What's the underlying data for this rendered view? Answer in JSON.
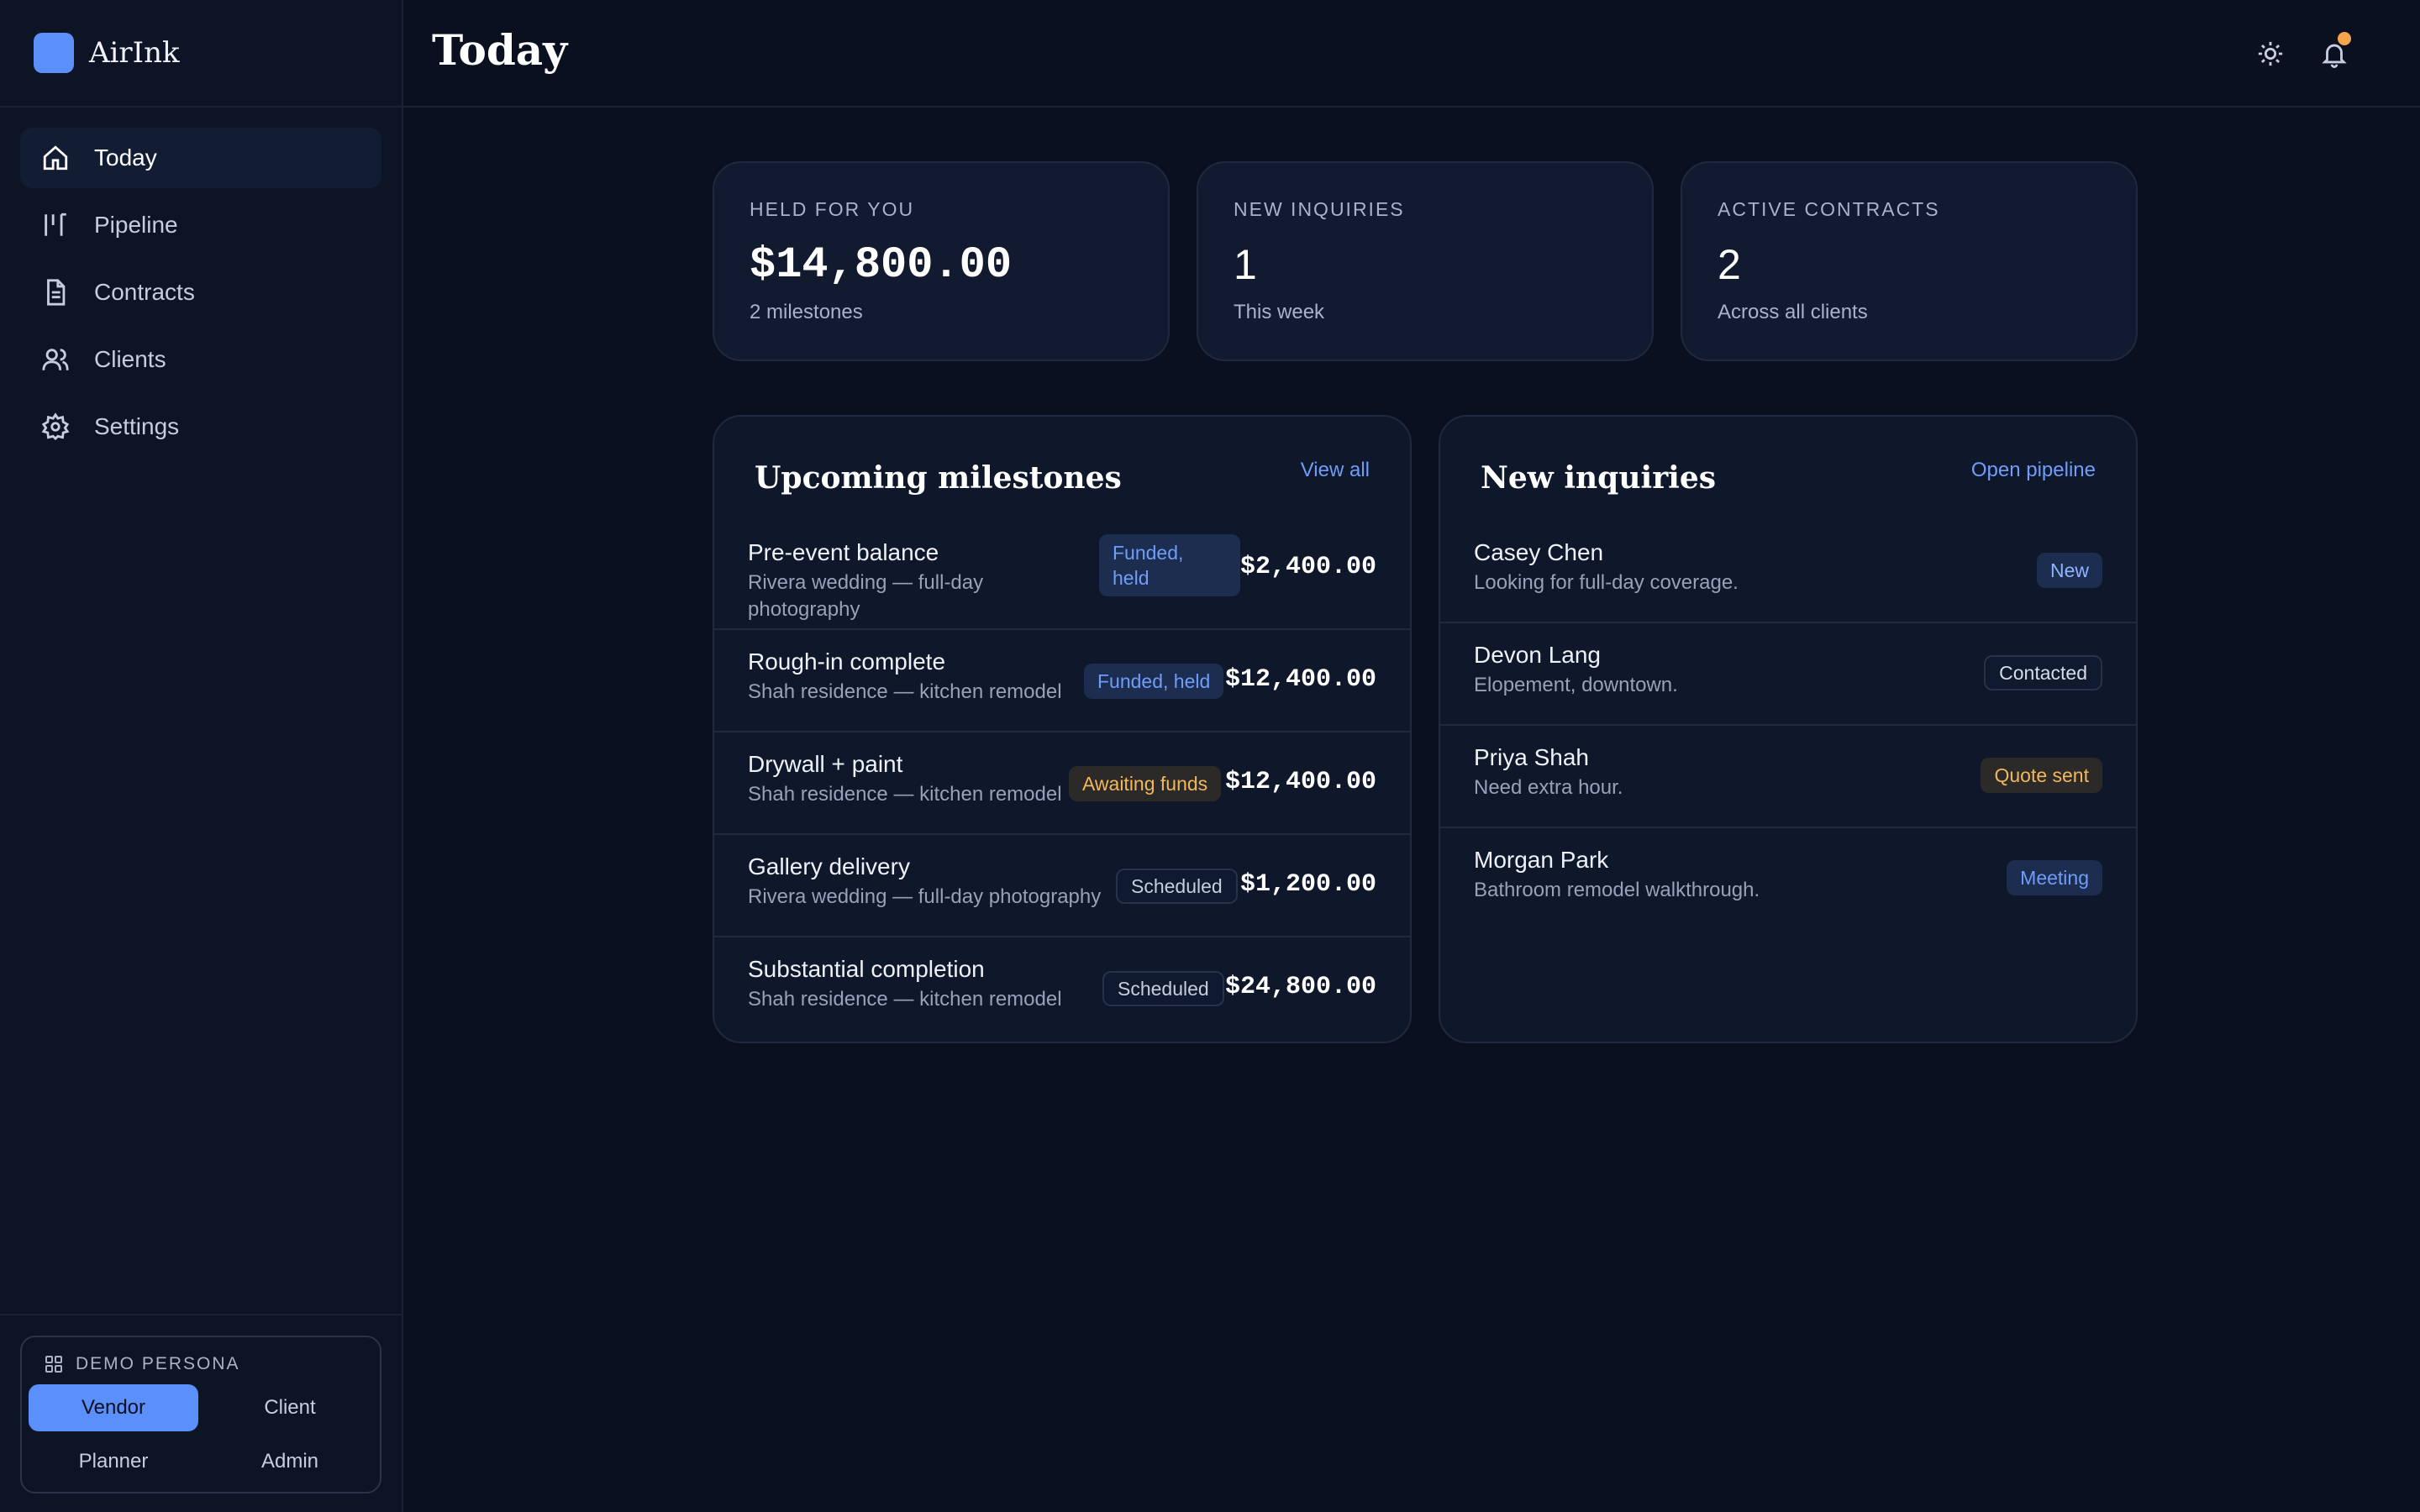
{
  "app": {
    "name": "AirInk"
  },
  "sidebar": {
    "items": [
      {
        "label": "Today",
        "icon": "home-icon",
        "active": true
      },
      {
        "label": "Pipeline",
        "icon": "pipeline-icon"
      },
      {
        "label": "Contracts",
        "icon": "document-icon"
      },
      {
        "label": "Clients",
        "icon": "users-icon"
      },
      {
        "label": "Settings",
        "icon": "gear-icon"
      }
    ],
    "persona": {
      "title": "DEMO PERSONA",
      "options": [
        "Vendor",
        "Client",
        "Planner",
        "Admin"
      ],
      "selected": "Vendor"
    }
  },
  "header": {
    "title": "Today"
  },
  "stats": [
    {
      "label": "HELD FOR YOU",
      "value": "$14,800.00",
      "sub": "2 milestones"
    },
    {
      "label": "NEW INQUIRIES",
      "value": "1",
      "sub": "This week"
    },
    {
      "label": "ACTIVE CONTRACTS",
      "value": "2",
      "sub": "Across all clients"
    }
  ],
  "milestones": {
    "title": "Upcoming milestones",
    "link": "View all",
    "rows": [
      {
        "title": "Pre-event balance",
        "sub_line1": "Rivera wedding — full-day",
        "sub_line2": "photography",
        "badge_line1": "Funded,",
        "badge_line2": "held",
        "amount": "$2,400.00"
      },
      {
        "title": "Rough-in complete",
        "sub": "Shah residence — kitchen remodel",
        "badge": "Funded, held",
        "amount": "$12,400.00"
      },
      {
        "title": "Drywall + paint",
        "sub": "Shah residence — kitchen remodel",
        "badge": "Awaiting funds",
        "amount": "$12,400.00"
      },
      {
        "title": "Gallery delivery",
        "sub": "Rivera wedding — full-day photography",
        "badge": "Scheduled",
        "amount": "$1,200.00"
      },
      {
        "title": "Substantial completion",
        "sub": "Shah residence — kitchen remodel",
        "badge": "Scheduled",
        "amount": "$24,800.00"
      }
    ]
  },
  "inquiries": {
    "title": "New inquiries",
    "link": "Open pipeline",
    "rows": [
      {
        "name": "Casey Chen",
        "sub": "Looking for full-day coverage.",
        "badge": "New"
      },
      {
        "name": "Devon Lang",
        "sub": "Elopement, downtown.",
        "badge": "Contacted"
      },
      {
        "name": "Priya Shah",
        "sub": "Need extra hour.",
        "badge": "Quote sent"
      },
      {
        "name": "Morgan Park",
        "sub": "Bathroom remodel walkthrough.",
        "badge": "Meeting"
      }
    ]
  },
  "colors": {
    "accent": "#5b8ff9",
    "notification": "#f4a64a",
    "warning": "#f2b75e",
    "background": "#0b1020"
  }
}
